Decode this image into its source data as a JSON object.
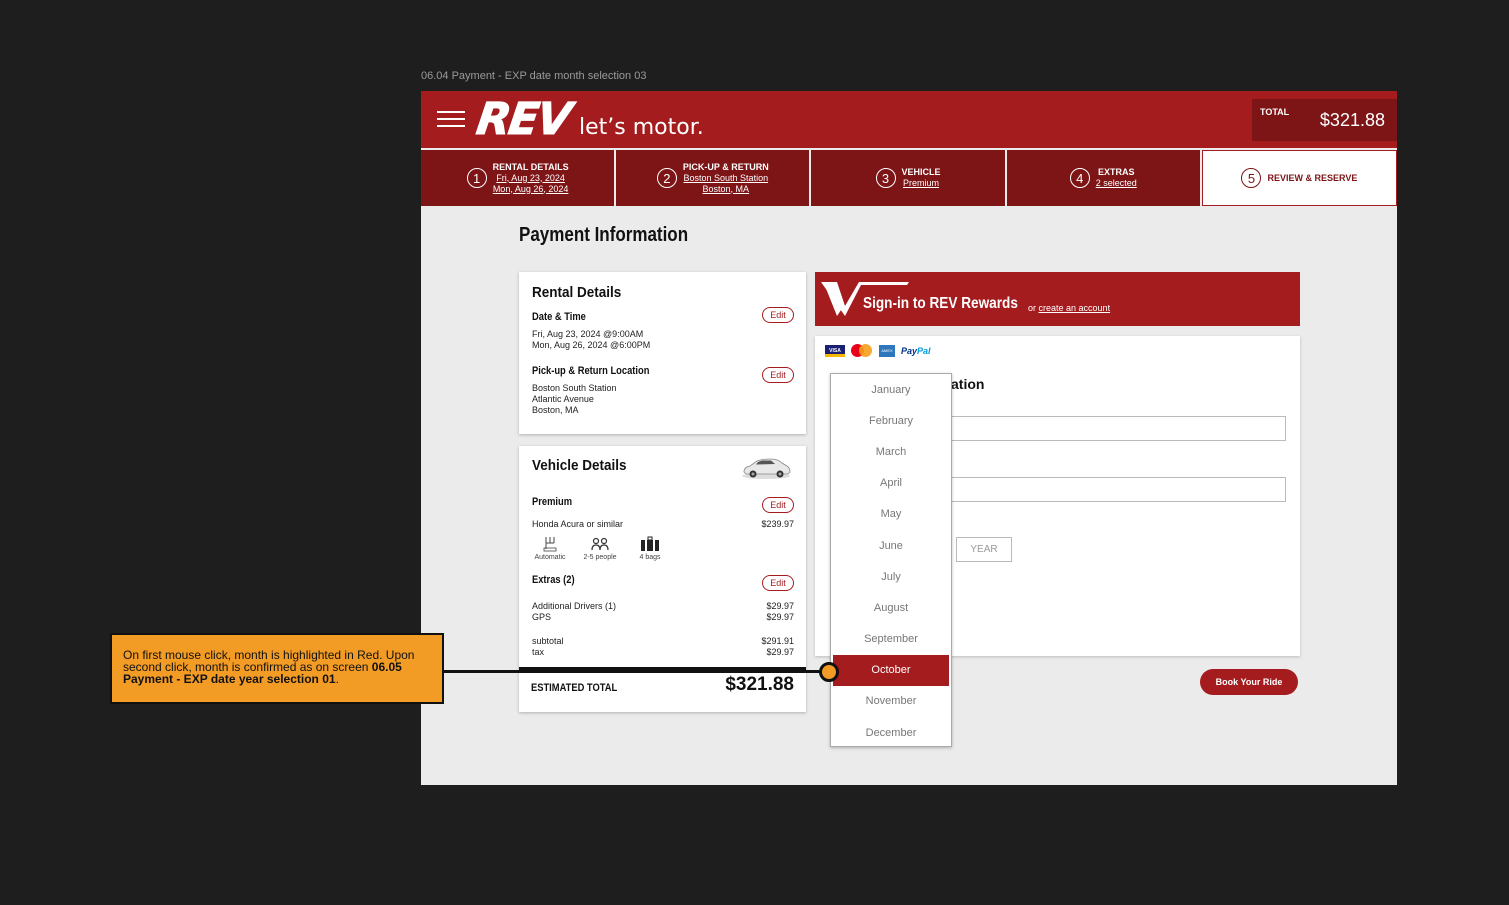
{
  "frame_label": "06.04 Payment - EXP date month selection 03",
  "header": {
    "logo_mark": "REV",
    "logo_tagline": "let’s motor.",
    "total_label": "TOTAL",
    "total_value": "$321.88"
  },
  "steps": [
    {
      "num": "1",
      "title": "RENTAL DETAILS",
      "sub1": "Fri, Aug 23, 2024",
      "sub2": "Mon, Aug 26, 2024"
    },
    {
      "num": "2",
      "title": "PICK-UP & RETURN",
      "sub1": "Boston South Station",
      "sub2": "Boston, MA"
    },
    {
      "num": "3",
      "title": "VEHICLE",
      "sub1": "Premium"
    },
    {
      "num": "4",
      "title": "EXTRAS",
      "sub1": "2 selected"
    },
    {
      "num": "5",
      "title": "REVIEW & RESERVE"
    }
  ],
  "page_title": "Payment Information",
  "rental": {
    "title": "Rental Details",
    "edit_label": "Edit",
    "date_heading": "Date & Time",
    "date_line1": "Fri, Aug 23, 2024 @9:00AM",
    "date_line2": "Mon, Aug 26, 2024 @6:00PM",
    "loc_heading": "Pick-up & Return Location",
    "loc_line1": "Boston South Station",
    "loc_line2": "Atlantic Avenue",
    "loc_line3": "Boston, MA"
  },
  "vehicle": {
    "title": "Vehicle Details",
    "class": "Premium",
    "model": "Honda Acura or similar",
    "price": "$239.97",
    "features": [
      {
        "icon": "transmission-icon",
        "label": "Automatic"
      },
      {
        "icon": "people-icon",
        "label": "2-5 people"
      },
      {
        "icon": "luggage-icon",
        "label": "4 bags"
      }
    ],
    "extras_heading": "Extras (2)",
    "extra1_label": "Additional Drivers (1)",
    "extra1_price": "$29.97",
    "extra2_label": "GPS",
    "extra2_price": "$29.97",
    "subtotal_label": "subtotal",
    "subtotal_value": "$291.91",
    "tax_label": "tax",
    "tax_value": "$29.97",
    "estimated_label": "ESTIMATED TOTAL",
    "estimated_value": "$321.88"
  },
  "rewards": {
    "title": "Sign-in to REV Rewards",
    "or_text": "or ",
    "link_text": "create an account"
  },
  "payment": {
    "title_visible": "ation",
    "paypal_a": "Pay",
    "paypal_b": "Pal",
    "visa": "VISA",
    "amex": "AMEX",
    "year_placeholder": "YEAR"
  },
  "book_button": "Book Your Ride",
  "months": [
    "January",
    "February",
    "March",
    "April",
    "May",
    "June",
    "July",
    "August",
    "September",
    "October",
    "November",
    "December"
  ],
  "selected_month": "October",
  "annotation": {
    "text1": "On first mouse click, month is highlighted in Red. Upon second click, month is confirmed as on screen ",
    "bold": "06.05 Payment - EXP date year selection 01",
    "text2": "."
  },
  "colors": {
    "brand_red": "#a51c1f",
    "dark_red": "#7d1416",
    "annotation_orange": "#f29b25"
  }
}
